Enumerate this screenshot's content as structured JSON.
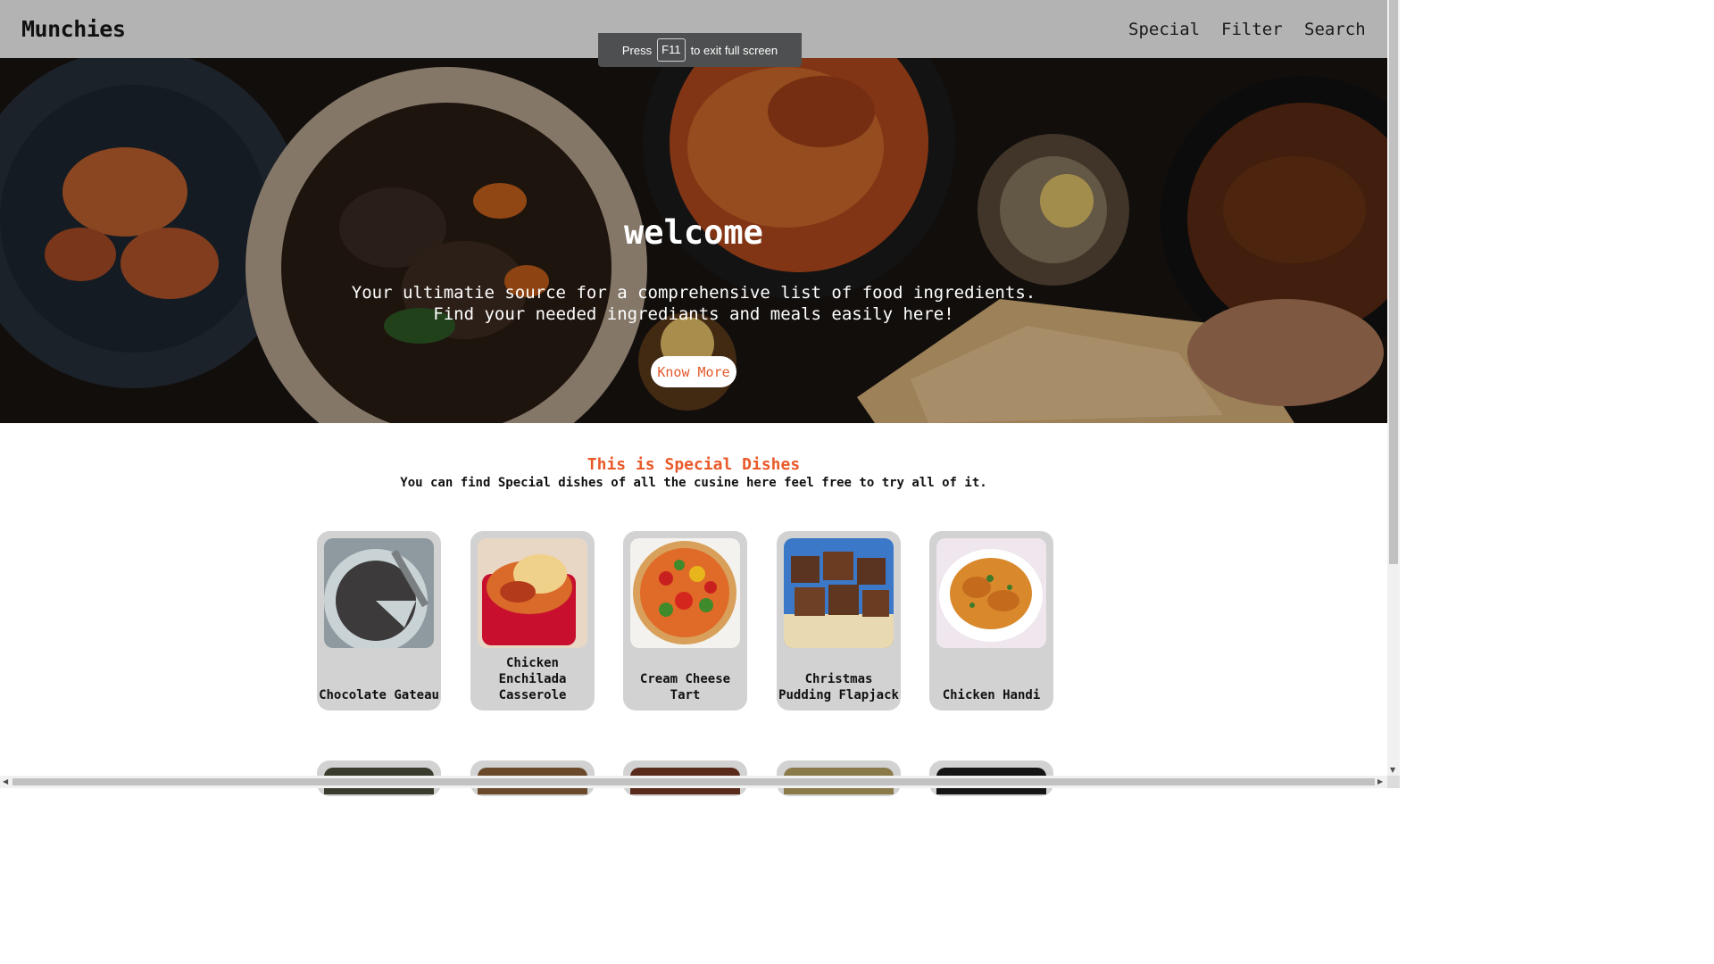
{
  "nav": {
    "brand": "Munchies",
    "links": [
      "Special",
      "Filter",
      "Search"
    ]
  },
  "fullscreen_notice": {
    "before": "Press",
    "key": "F11",
    "after": "to exit full screen"
  },
  "hero": {
    "title": "welcome",
    "subtitle": "Your ultimatie source for a comprehensive list of food ingredients.\nFind your needed ingrediants and meals easily here!",
    "button": "Know More"
  },
  "section": {
    "title": "This is Special Dishes",
    "subtitle": "You can find Special dishes of all the cusine here feel free to try all of it."
  },
  "dishes": [
    {
      "name": "Chocolate Gateau",
      "icon": "chocolate-gateau-image"
    },
    {
      "name": "Chicken Enchilada Casserole",
      "icon": "enchilada-casserole-image"
    },
    {
      "name": "Cream Cheese Tart",
      "icon": "cream-cheese-tart-image"
    },
    {
      "name": "Christmas Pudding Flapjack",
      "icon": "flapjack-image"
    },
    {
      "name": "Chicken Handi",
      "icon": "chicken-handi-image"
    }
  ],
  "colors": {
    "navbar": "#b3b3b3",
    "accent": "#e95a2a",
    "card": "#d2d2d2"
  }
}
